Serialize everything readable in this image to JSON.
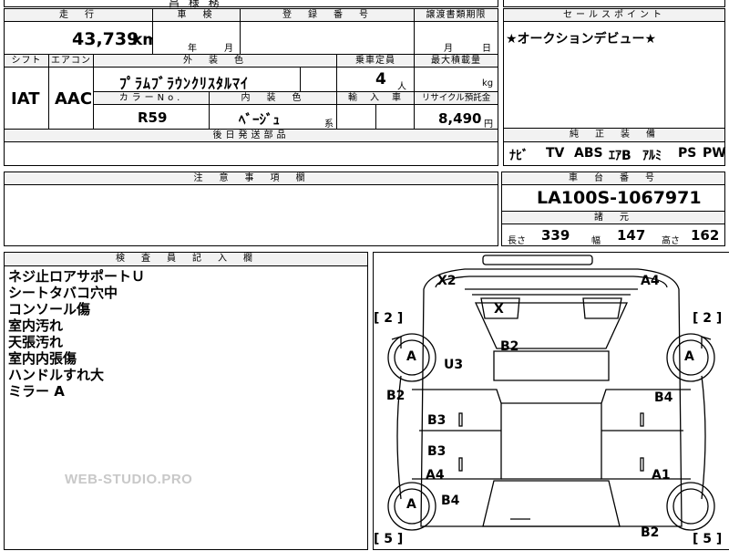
{
  "top_strip": {
    "truncated_text": "昌 様 務"
  },
  "headers": {
    "mileage": "走　行",
    "inspection": "車　検",
    "registration": "登　録　番　号",
    "transfer_deadline": "譲渡書類期限",
    "sales_point": "セールスポイント",
    "shift": "シフト",
    "aircon": "エアコン",
    "exterior_color": "外　装　色",
    "capacity": "乗車定員",
    "max_load": "最大積載量",
    "color_no": "カラーNo.",
    "interior_color": "内　装　色",
    "import": "輸　入　車",
    "recycle": "リサイクル預託金",
    "later_parts": "後日発送部品",
    "genuine_equipment": "純　正　装　備",
    "notes": "注　意　事　項　欄",
    "chassis_number": "車　台　番　号",
    "specs": "諸　元",
    "inspector_notes": "検　査　員　記　入　欄"
  },
  "values": {
    "mileage": "43,739",
    "mileage_unit": "km",
    "year_label": "年",
    "month_label": "月",
    "transfer_month": "月",
    "transfer_day": "日",
    "sales_point_text": "★オークションデビュー★",
    "shift": "IAT",
    "aircon": "AAC",
    "exterior_color": "ﾌﾟﾗﾑﾌﾞﾗｳﾝｸﾘｽﾀﾙﾏｲ",
    "capacity": "4",
    "capacity_unit": "人",
    "max_load_unit": "kg",
    "color_no": "R59",
    "interior_color": "ﾍﾞｰｼﾞｭ",
    "interior_suffix": "系",
    "recycle_amount": "8,490",
    "recycle_unit": "円",
    "equipment": [
      "ﾅﾋﾞ",
      "TV",
      "ABS",
      "ｴｱB",
      "ｱﾙﾐ",
      "PS",
      "PW"
    ],
    "chassis_number": "LA100S-1067971",
    "length_label": "長さ",
    "length": "339",
    "width_label": "幅",
    "width": "147",
    "height_label": "高さ",
    "height": "162"
  },
  "inspector_notes": [
    "ネジ止ロアサポートＵ",
    "シートタバコ穴中",
    "コンソール傷",
    "室内汚れ",
    "天張汚れ",
    "室内内張傷",
    "ハンドルすれ大",
    "ミラー A"
  ],
  "watermark": "WEB-STUDIO.PRO",
  "diagram": {
    "marks": {
      "x2": "X2",
      "a4_top": "A4",
      "x_windshield": "X",
      "bracket_left_top": "[ 2 ]",
      "bracket_right_top": "[ 2 ]",
      "a_front_left": "A",
      "a_front_right": "A",
      "u3": "U3",
      "b2_roof": "B2",
      "b2_left": "B2",
      "b4_right": "B4",
      "b3_upper": "B3",
      "b3_lower": "B3",
      "a4_left": "A4",
      "a1_right": "A1",
      "a_rear_left": "A",
      "b4_lower": "B4",
      "bracket_left_bottom": "[ 5 ]",
      "bracket_right_bottom": "[ 5 ]",
      "b2_rear": "B2"
    }
  }
}
